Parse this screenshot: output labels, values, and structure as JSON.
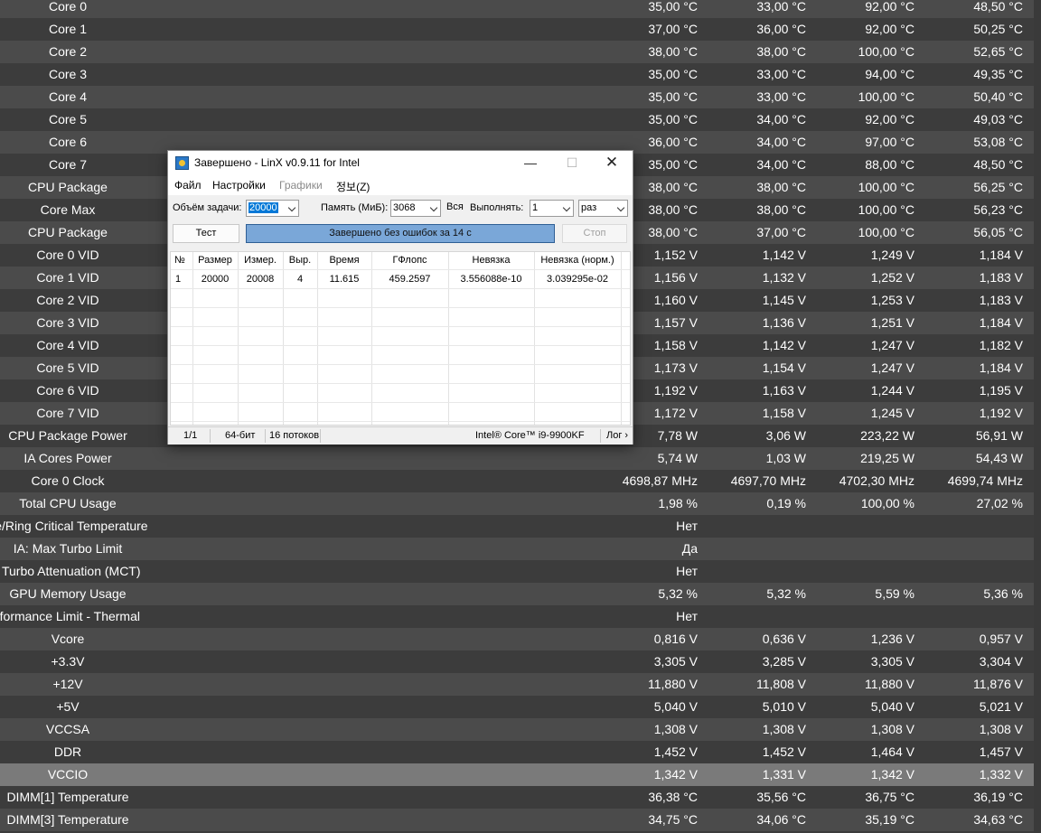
{
  "sensors": [
    {
      "name": "Core 0",
      "values": [
        "35,00 °C",
        "33,00 °C",
        "92,00 °C",
        "48,50 °C"
      ]
    },
    {
      "name": "Core 1",
      "values": [
        "37,00 °C",
        "36,00 °C",
        "92,00 °C",
        "50,25 °C"
      ]
    },
    {
      "name": "Core 2",
      "values": [
        "38,00 °C",
        "38,00 °C",
        "100,00 °C",
        "52,65 °C"
      ]
    },
    {
      "name": "Core 3",
      "values": [
        "35,00 °C",
        "33,00 °C",
        "94,00 °C",
        "49,35 °C"
      ]
    },
    {
      "name": "Core 4",
      "values": [
        "35,00 °C",
        "33,00 °C",
        "100,00 °C",
        "50,40 °C"
      ]
    },
    {
      "name": "Core 5",
      "values": [
        "35,00 °C",
        "34,00 °C",
        "92,00 °C",
        "49,03 °C"
      ]
    },
    {
      "name": "Core 6",
      "values": [
        "36,00 °C",
        "34,00 °C",
        "97,00 °C",
        "53,08 °C"
      ]
    },
    {
      "name": "Core 7",
      "values": [
        "35,00 °C",
        "34,00 °C",
        "88,00 °C",
        "48,50 °C"
      ]
    },
    {
      "name": "CPU Package",
      "values": [
        "38,00 °C",
        "38,00 °C",
        "100,00 °C",
        "56,25 °C"
      ]
    },
    {
      "name": "Core Max",
      "values": [
        "38,00 °C",
        "38,00 °C",
        "100,00 °C",
        "56,23 °C"
      ]
    },
    {
      "name": "CPU Package",
      "values": [
        "38,00 °C",
        "37,00 °C",
        "100,00 °C",
        "56,05 °C"
      ]
    },
    {
      "name": "Core 0 VID",
      "values": [
        "1,152 V",
        "1,142 V",
        "1,249 V",
        "1,184 V"
      ]
    },
    {
      "name": "Core 1 VID",
      "values": [
        "1,156 V",
        "1,132 V",
        "1,252 V",
        "1,183 V"
      ]
    },
    {
      "name": "Core 2 VID",
      "values": [
        "1,160 V",
        "1,145 V",
        "1,253 V",
        "1,183 V"
      ]
    },
    {
      "name": "Core 3 VID",
      "values": [
        "1,157 V",
        "1,136 V",
        "1,251 V",
        "1,184 V"
      ]
    },
    {
      "name": "Core 4 VID",
      "values": [
        "1,158 V",
        "1,142 V",
        "1,247 V",
        "1,182 V"
      ]
    },
    {
      "name": "Core 5 VID",
      "values": [
        "1,173 V",
        "1,154 V",
        "1,247 V",
        "1,184 V"
      ]
    },
    {
      "name": "Core 6 VID",
      "values": [
        "1,192 V",
        "1,163 V",
        "1,244 V",
        "1,195 V"
      ]
    },
    {
      "name": "Core 7 VID",
      "values": [
        "1,172 V",
        "1,158 V",
        "1,245 V",
        "1,192 V"
      ]
    },
    {
      "name": "CPU Package Power",
      "values": [
        "7,78 W",
        "3,06 W",
        "223,22 W",
        "56,91 W"
      ]
    },
    {
      "name": "IA Cores Power",
      "values": [
        "5,74 W",
        "1,03 W",
        "219,25 W",
        "54,43 W"
      ]
    },
    {
      "name": "Core 0 Clock",
      "values": [
        "4698,87 MHz",
        "4697,70 MHz",
        "4702,30 MHz",
        "4699,74 MHz"
      ]
    },
    {
      "name": "Total CPU Usage",
      "values": [
        "1,98 %",
        "0,19 %",
        "100,00 %",
        "27,02 %"
      ]
    },
    {
      "name": "ge/Ring Critical Temperature",
      "values": [
        "Нет",
        "",
        "",
        ""
      ]
    },
    {
      "name": "IA: Max Turbo Limit",
      "values": [
        "Да",
        "",
        "",
        ""
      ]
    },
    {
      "name": ": Turbo Attenuation (MCT)",
      "values": [
        "Нет",
        "",
        "",
        ""
      ]
    },
    {
      "name": "GPU Memory Usage",
      "values": [
        "5,32 %",
        "5,32 %",
        "5,59 %",
        "5,36 %"
      ]
    },
    {
      "name": "rformance Limit - Thermal",
      "values": [
        "Нет",
        "",
        "",
        ""
      ]
    },
    {
      "name": "Vcore",
      "values": [
        "0,816 V",
        "0,636 V",
        "1,236 V",
        "0,957 V"
      ]
    },
    {
      "name": "+3.3V",
      "values": [
        "3,305 V",
        "3,285 V",
        "3,305 V",
        "3,304 V"
      ]
    },
    {
      "name": "+12V",
      "values": [
        "11,880 V",
        "11,808 V",
        "11,880 V",
        "11,876 V"
      ]
    },
    {
      "name": "+5V",
      "values": [
        "5,040 V",
        "5,010 V",
        "5,040 V",
        "5,021 V"
      ]
    },
    {
      "name": "VCCSA",
      "values": [
        "1,308 V",
        "1,308 V",
        "1,308 V",
        "1,308 V"
      ]
    },
    {
      "name": "DDR",
      "values": [
        "1,452 V",
        "1,452 V",
        "1,464 V",
        "1,457 V"
      ]
    },
    {
      "name": "VCCIO",
      "values": [
        "1,342 V",
        "1,331 V",
        "1,342 V",
        "1,332 V"
      ]
    },
    {
      "name": "DIMM[1] Temperature",
      "values": [
        "36,38 °C",
        "35,56 °C",
        "36,75 °C",
        "36,19 °C"
      ]
    },
    {
      "name": "DIMM[3] Temperature",
      "values": [
        "34,75 °C",
        "34,06 °C",
        "35,19 °C",
        "34,63 °C"
      ]
    }
  ],
  "highlighted_row": "VCCIO",
  "linx": {
    "title": "Завершено - LinX v0.9.11 for Intel",
    "menu": {
      "file": "Файл",
      "settings": "Настройки",
      "graphs": "Графики",
      "info": "정보(Z)"
    },
    "task_size_label": "Объём задачи:",
    "task_size_value": "20000",
    "memory_label": "Память (МиБ):",
    "memory_value": "3068",
    "all_label": "Вся",
    "run_label": "Выполнять:",
    "run_count": "1",
    "run_unit": "раз",
    "test_button": "Тест",
    "progress_text": "Завершено без ошибок за 14 с",
    "stop_button": "Стоп",
    "columns": [
      "№",
      "Размер",
      "Измер.",
      "Выр.",
      "Время",
      "ГФлопс",
      "Невязка",
      "Невязка (норм.)"
    ],
    "rows": [
      [
        "1",
        "20000",
        "20008",
        "4",
        "11.615",
        "459.2597",
        "3.556088e-10",
        "3.039295e-02"
      ]
    ],
    "status": {
      "runs": "1/1",
      "bits": "64-бит",
      "threads": "16 потоков",
      "cpu": "Intel® Core™ i9-9900KF",
      "log": "Лог"
    }
  },
  "colors": {
    "row_odd": "#4b4b4b",
    "row_even": "#3c3c3c",
    "row_highlight": "#7a7a7a",
    "progress": "#7aa7d8"
  },
  "icons": [
    "linx-app-icon",
    "minimize-icon",
    "maximize-icon",
    "close-icon",
    "dropdown-arrow-icon",
    "log-arrow-icon"
  ]
}
